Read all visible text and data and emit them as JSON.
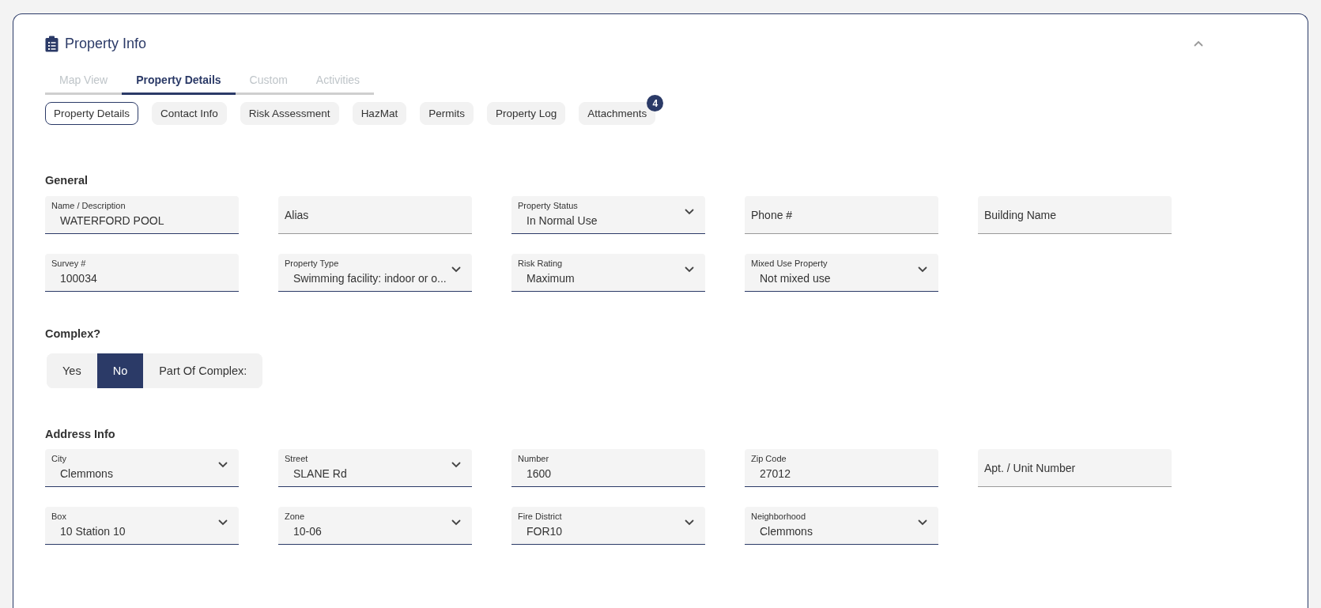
{
  "card": {
    "title": "Property Info",
    "collapsed": false
  },
  "tabs": [
    {
      "label": "Map View",
      "selected": false
    },
    {
      "label": "Property Details",
      "selected": true
    },
    {
      "label": "Custom",
      "selected": false
    },
    {
      "label": "Activities",
      "selected": false
    }
  ],
  "subtabs": [
    {
      "label": "Property Details",
      "selected": true
    },
    {
      "label": "Contact Info",
      "selected": false
    },
    {
      "label": "Risk Assessment",
      "selected": false
    },
    {
      "label": "HazMat",
      "selected": false
    },
    {
      "label": "Permits",
      "selected": false
    },
    {
      "label": "Property Log",
      "selected": false
    },
    {
      "label": "Attachments",
      "selected": false,
      "badge": "4"
    }
  ],
  "general": {
    "heading": "General",
    "rows": [
      [
        {
          "kind": "text",
          "label": "Name / Description",
          "value": "WATERFORD POOL"
        },
        {
          "kind": "text",
          "label": "Alias"
        },
        {
          "kind": "select",
          "label": "Property Status",
          "value": "In Normal Use"
        },
        {
          "kind": "text",
          "label": "Phone #"
        },
        {
          "kind": "text",
          "label": "Building Name"
        }
      ],
      [
        {
          "kind": "text",
          "label": "Survey #",
          "value": "100034"
        },
        {
          "kind": "select",
          "label": "Property Type",
          "value": "Swimming facility: indoor or o..."
        },
        {
          "kind": "select",
          "label": "Risk Rating",
          "value": "Maximum"
        },
        {
          "kind": "select",
          "label": "Mixed Use Property",
          "value": "Not mixed use"
        }
      ]
    ]
  },
  "complex": {
    "heading": "Complex?",
    "options": [
      {
        "label": "Yes",
        "selected": false
      },
      {
        "label": "No",
        "selected": true
      },
      {
        "label": "Part Of Complex:",
        "selected": false
      }
    ]
  },
  "address": {
    "heading": "Address Info",
    "rows": [
      [
        {
          "kind": "select",
          "label": "City",
          "value": "Clemmons"
        },
        {
          "kind": "select",
          "label": "Street",
          "value": "SLANE Rd"
        },
        {
          "kind": "text",
          "label": "Number",
          "value": "1600"
        },
        {
          "kind": "text",
          "label": "Zip Code",
          "value": "27012"
        },
        {
          "kind": "text",
          "label": "Apt. / Unit Number"
        }
      ],
      [
        {
          "kind": "select",
          "label": "Box",
          "value": "10 Station 10"
        },
        {
          "kind": "select",
          "label": "Zone",
          "value": "10-06"
        },
        {
          "kind": "select",
          "label": "Fire District",
          "value": "FOR10"
        },
        {
          "kind": "select",
          "label": "Neighborhood",
          "value": "Clemmons"
        }
      ]
    ]
  }
}
